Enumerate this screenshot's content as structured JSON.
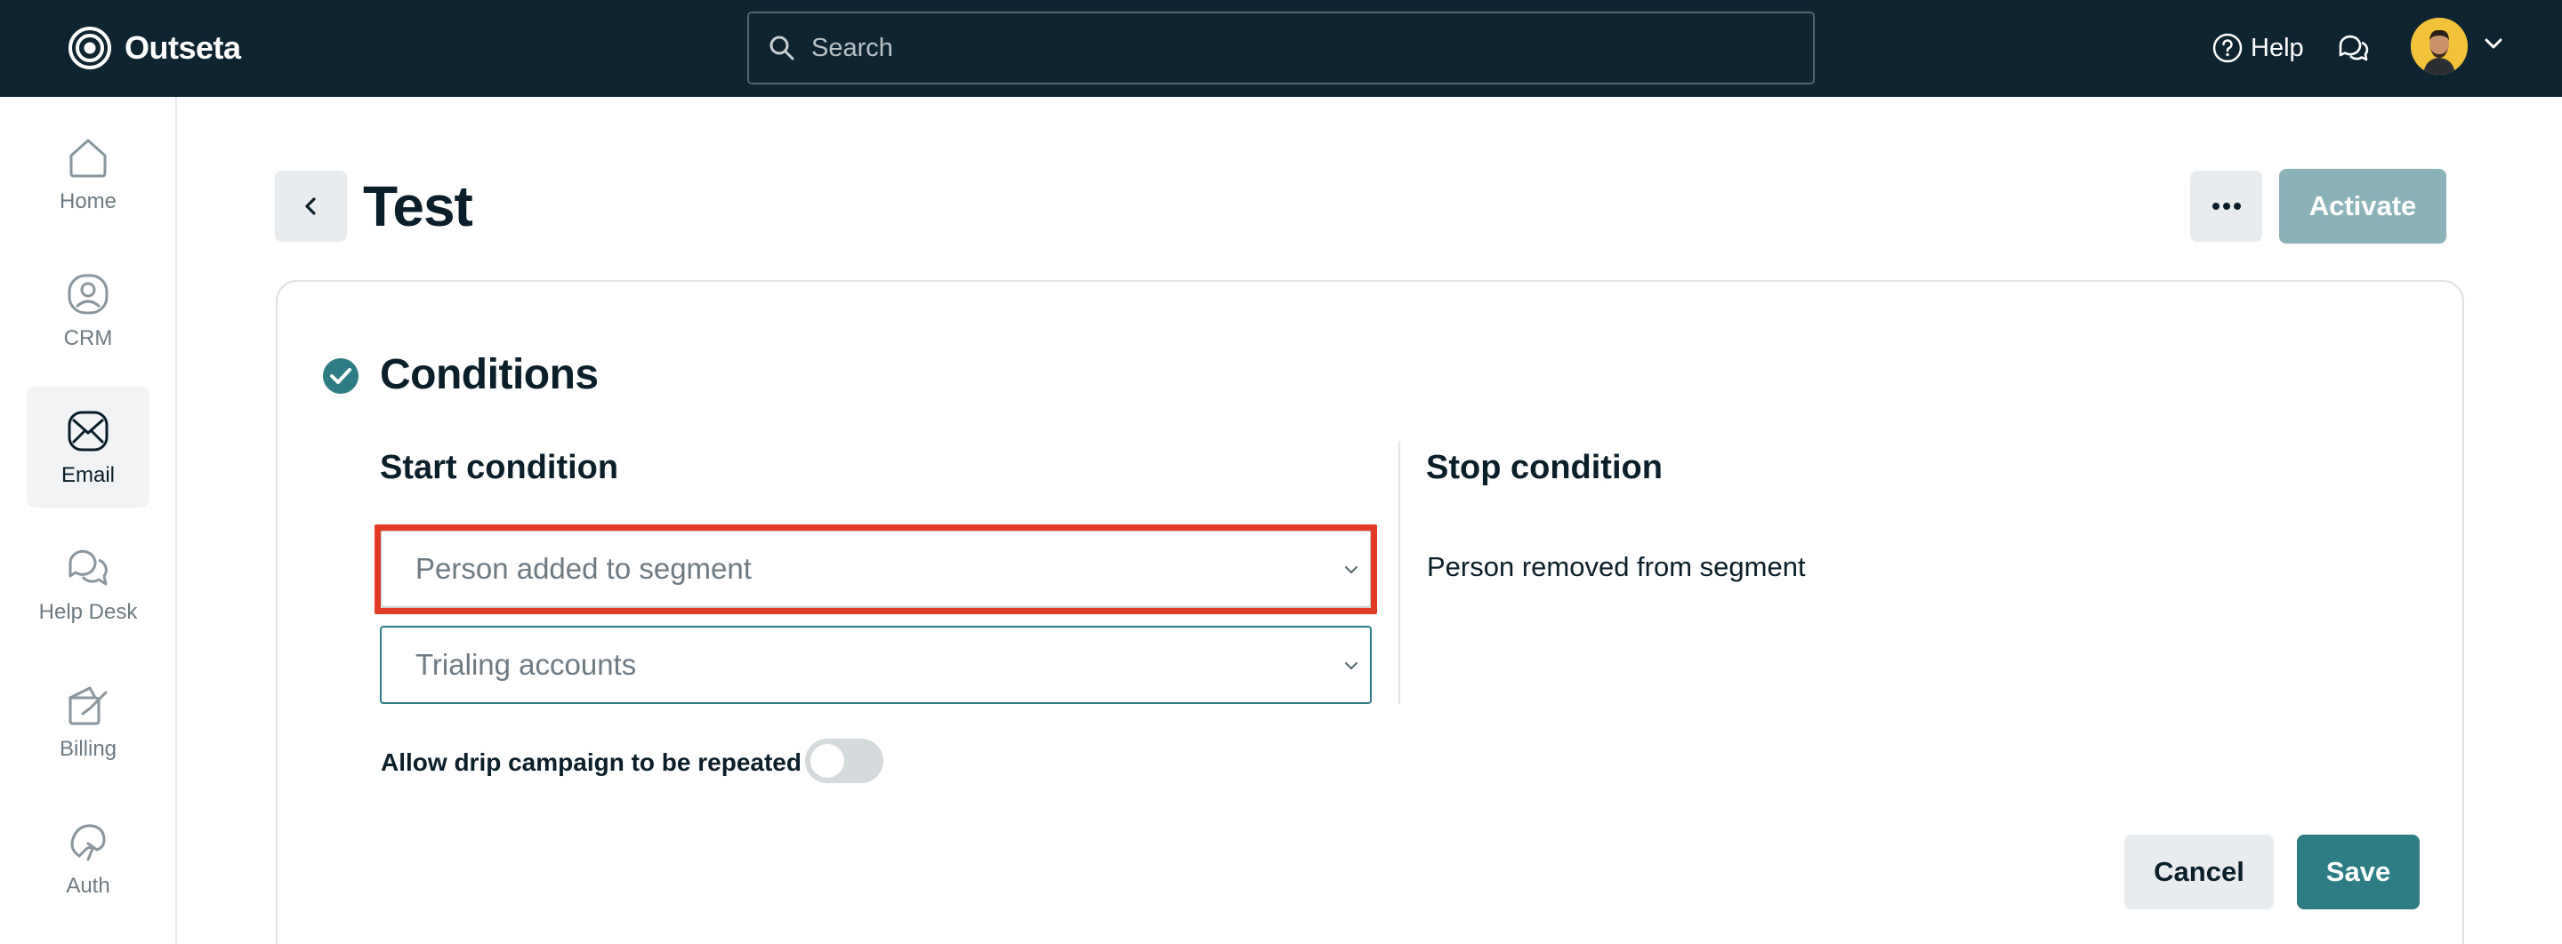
{
  "app": {
    "name": "Outseta"
  },
  "header": {
    "search_placeholder": "Search",
    "help_label": "Help"
  },
  "sidebar": {
    "items": [
      {
        "label": "Home",
        "icon": "home-icon"
      },
      {
        "label": "CRM",
        "icon": "crm-icon"
      },
      {
        "label": "Email",
        "icon": "email-icon",
        "active": true
      },
      {
        "label": "Help Desk",
        "icon": "help-desk-icon"
      },
      {
        "label": "Billing",
        "icon": "billing-icon"
      },
      {
        "label": "Auth",
        "icon": "auth-icon"
      }
    ]
  },
  "page": {
    "title": "Test",
    "activate_label": "Activate"
  },
  "conditions": {
    "title": "Conditions",
    "start_title": "Start condition",
    "start_trigger": "Person added to segment",
    "start_segment": "Trialing accounts",
    "stop_title": "Stop condition",
    "stop_text": "Person removed from segment",
    "repeat_label": "Allow drip campaign to be repeated",
    "repeat_enabled": false,
    "cancel_label": "Cancel",
    "save_label": "Save"
  },
  "colors": {
    "topbar": "#0e2430",
    "accent": "#2e7d86",
    "activate_disabled": "#8ab3b9",
    "highlight": "#e23b25"
  }
}
